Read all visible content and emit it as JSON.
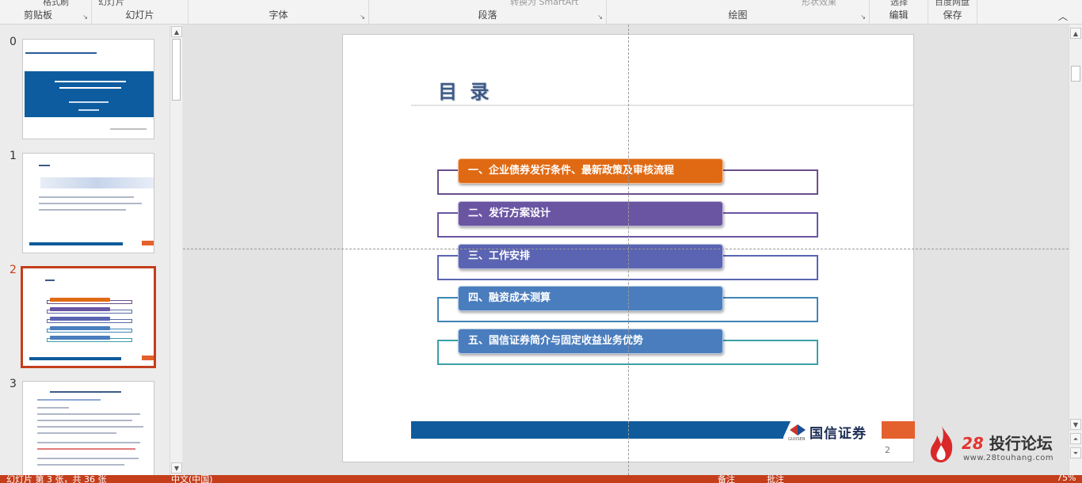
{
  "ribbon": {
    "groups": [
      {
        "label": "剪贴板",
        "top_text": "格式刷"
      },
      {
        "label": "幻灯片",
        "top_text": "幻灯片"
      },
      {
        "label": "字体",
        "top_text": ""
      },
      {
        "label": "段落",
        "top_text": "转换为 SmartArt"
      },
      {
        "label": "绘图",
        "top_text": "形状效果"
      },
      {
        "label": "编辑",
        "top_text": "选择"
      },
      {
        "label": "保存",
        "top_text": "百度网盘"
      }
    ],
    "collapse_icon": "chevron-up-icon"
  },
  "thumbnails": {
    "items": [
      {
        "number": "0",
        "active": false
      },
      {
        "number": "1",
        "active": false
      },
      {
        "number": "2",
        "active": true
      },
      {
        "number": "3",
        "active": false
      }
    ]
  },
  "slide": {
    "title": "目 录",
    "items": [
      {
        "label": "一、企业债券发行条件、最新政策及审核流程",
        "color": "#e06a14",
        "frame_color": "#6a4f8a"
      },
      {
        "label": "二、发行方案设计",
        "color": "#6a55a3",
        "frame_color": "#6a55a3"
      },
      {
        "label": "三、工作安排",
        "color": "#5a64b2",
        "frame_color": "#5a64b2"
      },
      {
        "label": "四、融资成本测算",
        "color": "#4a7dbd",
        "frame_color": "#3f86b4"
      },
      {
        "label": "五、国信证券简介与固定收益业务优势",
        "color": "#4a7dbd",
        "frame_color": "#3aa0a6"
      }
    ],
    "logo_text": "国信证券",
    "logo_sub": "GUOSEN",
    "page_number": "2"
  },
  "watermark": {
    "title_num": "28",
    "title_text": "投行论坛",
    "url": "www.28touhang.com"
  },
  "status": {
    "slide_info": "幻灯片 第 3 张，共 36 张",
    "language": "中文(中国)",
    "notes": "备注",
    "comments": "批注",
    "zoom": "75%"
  },
  "colors": {
    "accent": "#c43e1c",
    "blue": "#0f5b9c",
    "orange": "#e4612d"
  }
}
